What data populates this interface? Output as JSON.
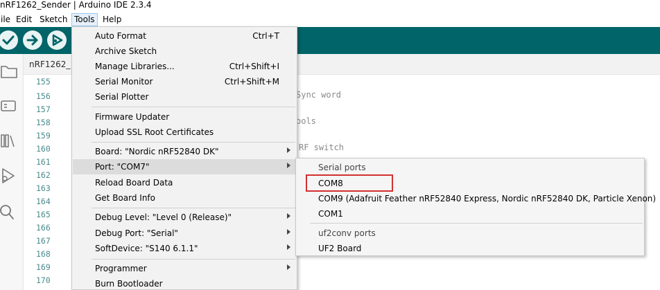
{
  "window": {
    "title": "nRF1262_Sender | Arduino IDE 2.3.4"
  },
  "menubar": {
    "file": "ile",
    "edit": "Edit",
    "sketch": "Sketch",
    "tools": "Tools",
    "help": "Help"
  },
  "toolbar": {
    "verify_icon": "check-icon",
    "upload_icon": "arrow-right-icon",
    "debug_icon": "debug-icon"
  },
  "tab": {
    "label": "nRF1262_"
  },
  "gutter": {
    "lines": [
      "155",
      "156",
      "157",
      "158",
      "159",
      "160",
      "161",
      "162",
      "163",
      "164",
      "165",
      "166",
      "167",
      "168",
      "169",
      "170"
    ]
  },
  "code": {
    "l156": "Sync word",
    "l158": "ools",
    "l160": "RF switch"
  },
  "tools_menu": {
    "auto_format": "Auto Format",
    "auto_format_sc": "Ctrl+T",
    "archive_sketch": "Archive Sketch",
    "manage_libraries": "Manage Libraries...",
    "manage_libraries_sc": "Ctrl+Shift+I",
    "serial_monitor": "Serial Monitor",
    "serial_monitor_sc": "Ctrl+Shift+M",
    "serial_plotter": "Serial Plotter",
    "firmware_updater": "Firmware Updater",
    "upload_ssl": "Upload SSL Root Certificates",
    "board": "Board: \"Nordic nRF52840 DK\"",
    "port": "Port: \"COM7\"",
    "reload_board": "Reload Board Data",
    "get_board_info": "Get Board Info",
    "debug_level": "Debug Level: \"Level 0 (Release)\"",
    "debug_port": "Debug Port: \"Serial\"",
    "softdevice": "SoftDevice: \"S140 6.1.1\"",
    "programmer": "Programmer",
    "burn_bootloader": "Burn Bootloader"
  },
  "port_submenu": {
    "serial_header": "Serial ports",
    "com8": "COM8",
    "com9": "COM9 (Adafruit Feather nRF52840 Express, Nordic nRF52840 DK, Particle Xenon)",
    "com1": "COM1",
    "uf2_header": "uf2conv ports",
    "uf2_board": "UF2 Board"
  },
  "colors": {
    "toolbar": "#006468",
    "highlight_box": "#d32f2f"
  }
}
